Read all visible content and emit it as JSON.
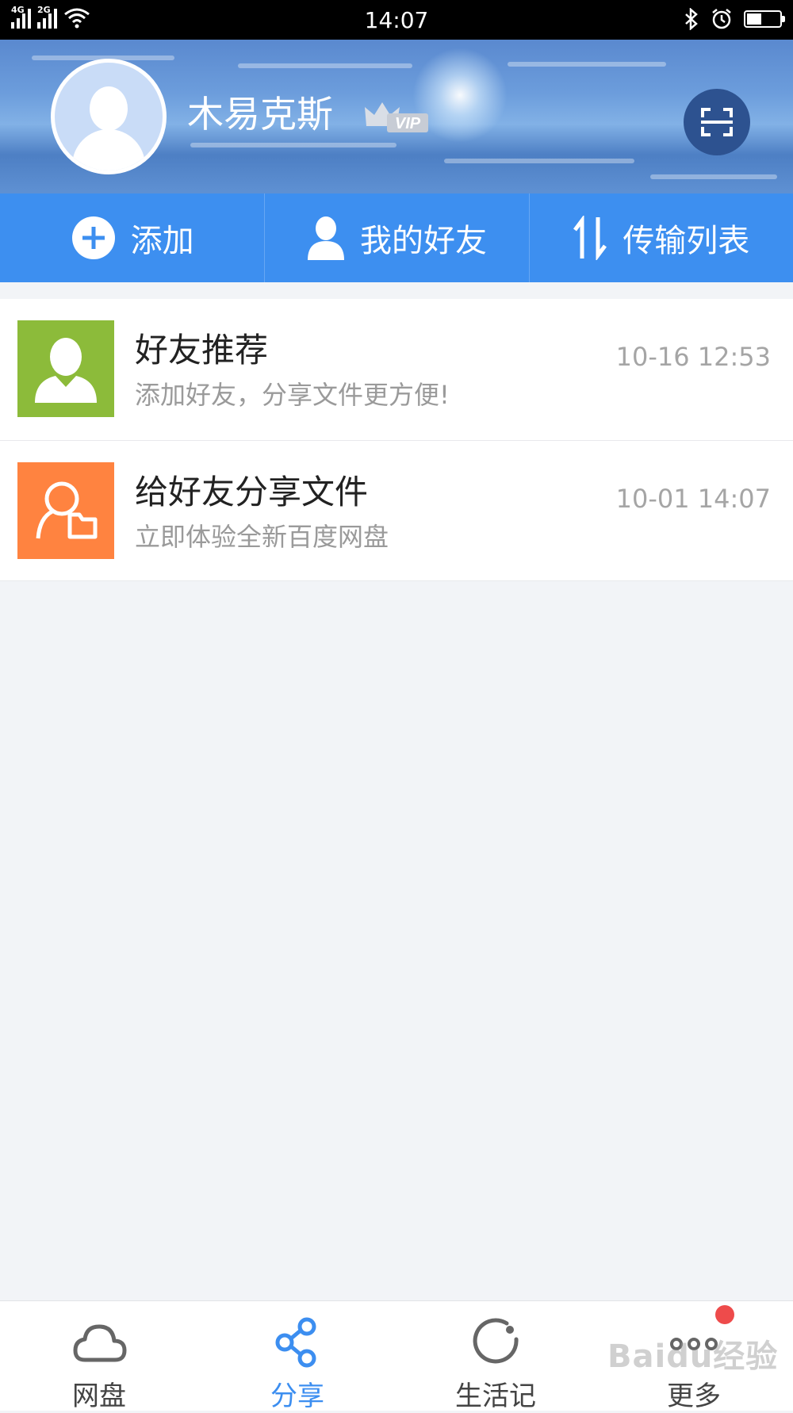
{
  "status_bar": {
    "net1": "4G",
    "net2": "2G",
    "time": "14:07",
    "battery_level": 0.45
  },
  "profile": {
    "username": "木易克斯",
    "vip_label": "VIP"
  },
  "actions": [
    {
      "label": "添加",
      "icon": "plus-circle-icon"
    },
    {
      "label": "我的好友",
      "icon": "person-icon"
    },
    {
      "label": "传输列表",
      "icon": "transfer-arrows-icon"
    }
  ],
  "list": [
    {
      "title": "好友推荐",
      "subtitle": "添加好友，分享文件更方便!",
      "time": "10-16 12:53",
      "icon": "friend-recommend-icon",
      "color": "#8cbb3a"
    },
    {
      "title": "给好友分享文件",
      "subtitle": "立即体验全新百度网盘",
      "time": "10-01 14:07",
      "icon": "share-file-icon",
      "color": "#ff8340"
    }
  ],
  "nav": [
    {
      "label": "网盘",
      "icon": "cloud-icon"
    },
    {
      "label": "分享",
      "icon": "share-icon",
      "active": true
    },
    {
      "label": "生活记",
      "icon": "life-record-icon"
    },
    {
      "label": "更多",
      "icon": "more-icon"
    }
  ],
  "watermark": "Baidu经验",
  "colors": {
    "accent": "#3d8ff0",
    "active_tab": "#3c8ef0",
    "badge": "#ee4b4b"
  }
}
